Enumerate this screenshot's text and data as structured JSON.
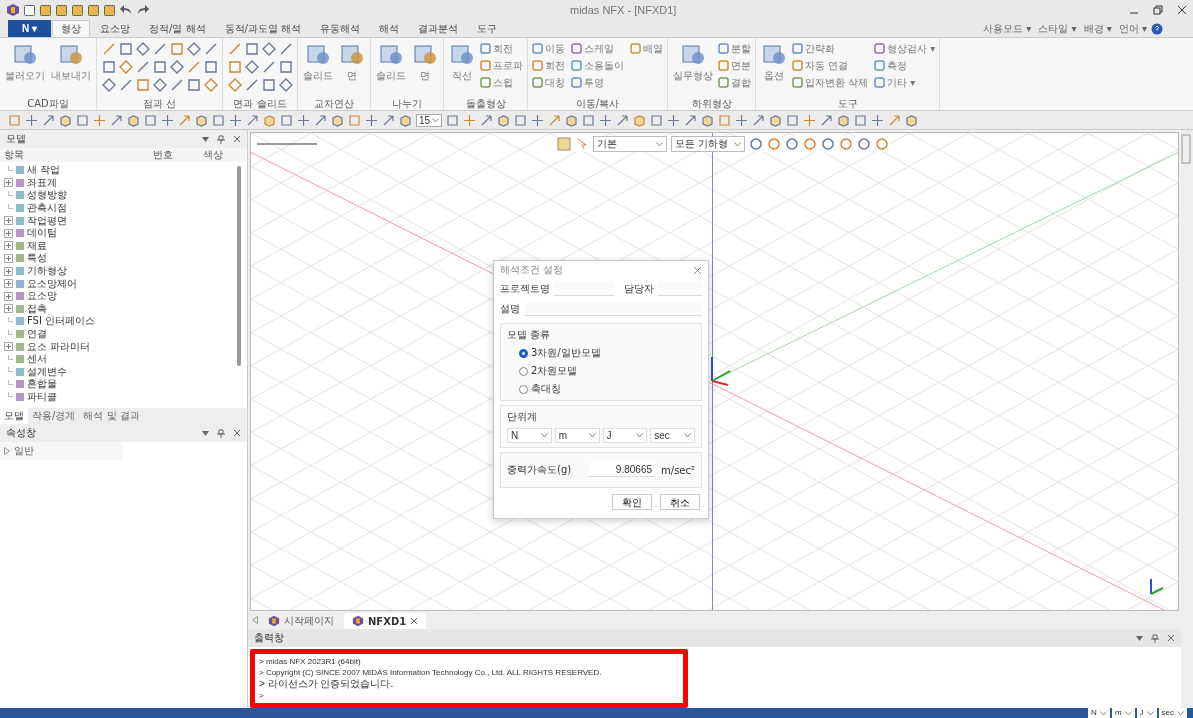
{
  "window": {
    "title": "midas NFX - [NFXD1]"
  },
  "top_right_menu": [
    "사용모드 ▾",
    "스타일 ▾",
    "배경 ▾",
    "언어 ▾"
  ],
  "app_menu": {
    "label": "N ▾"
  },
  "ribbon_tabs": [
    {
      "label": "형상",
      "selected": true
    },
    {
      "label": "요소망",
      "selected": false
    },
    {
      "label": "정적/열 해석",
      "selected": false
    },
    {
      "label": "동적/과도열 해석",
      "selected": false
    },
    {
      "label": "유동해석",
      "selected": false
    },
    {
      "label": "해석",
      "selected": false
    },
    {
      "label": "결과분석",
      "selected": false
    },
    {
      "label": "도구",
      "selected": false
    }
  ],
  "ribbon_groups": [
    {
      "kind": "large",
      "label": "CAD파일",
      "buttons": [
        "불러오기",
        "내보내기"
      ]
    },
    {
      "kind": "grid",
      "label": "점과 선"
    },
    {
      "kind": "grid",
      "label": "면과 솔리드"
    },
    {
      "kind": "large",
      "label": "교차연산",
      "buttons": [
        "솔리드",
        "면"
      ]
    },
    {
      "kind": "large",
      "label": "나누기",
      "buttons": [
        "솔리드",
        "면"
      ]
    },
    {
      "kind": "mixed",
      "label": "돌출형상",
      "buttons": [
        "직선"
      ],
      "items": [
        "회전",
        "프로파",
        "스윕"
      ]
    },
    {
      "kind": "mixed",
      "label": "이동/복사",
      "items": [
        "이동",
        "회전",
        "대칭",
        "스케일",
        "소용돌이",
        "투영",
        "배열"
      ]
    },
    {
      "kind": "mixed",
      "label": "하위형상",
      "buttons": [
        "실무형상"
      ],
      "items": [
        "분할",
        "면분",
        "결합"
      ]
    },
    {
      "kind": "mixed",
      "label": "도구",
      "buttons": [
        "옵션"
      ],
      "items": [
        "간략화",
        "자동 연결",
        "입자변환 삭제",
        "형상검사 ▾",
        "측정",
        "기타 ▾"
      ]
    }
  ],
  "toolbar": {
    "step_value": "15"
  },
  "model_panel": {
    "title": "모델",
    "columns": [
      "항목",
      "번호",
      "색상"
    ],
    "tree": [
      {
        "label": "새 작업",
        "expandable": false
      },
      {
        "label": "좌표계",
        "expandable": true
      },
      {
        "label": "성형방향",
        "expandable": false
      },
      {
        "label": "관측시점",
        "expandable": false
      },
      {
        "label": "작업평면",
        "expandable": true
      },
      {
        "label": "데이텀",
        "expandable": true
      },
      {
        "label": "재료",
        "expandable": true
      },
      {
        "label": "특성",
        "expandable": true
      },
      {
        "label": "기하형상",
        "expandable": true
      },
      {
        "label": "요소망제어",
        "expandable": true
      },
      {
        "label": "요소망",
        "expandable": true
      },
      {
        "label": "접촉",
        "expandable": true
      },
      {
        "label": "FSI 인터페이스",
        "expandable": false
      },
      {
        "label": "연결",
        "expandable": false
      },
      {
        "label": "요소 파라미터",
        "expandable": true
      },
      {
        "label": "센서",
        "expandable": false
      },
      {
        "label": "설계변수",
        "expandable": false
      },
      {
        "label": "혼합물",
        "expandable": false
      },
      {
        "label": "파티클",
        "expandable": false
      }
    ],
    "tabs": [
      {
        "label": "모델",
        "selected": true
      },
      {
        "label": "작용/경계",
        "selected": false
      },
      {
        "label": "해석 및 결과",
        "selected": false
      }
    ]
  },
  "property_panel": {
    "title": "속성창",
    "rows": [
      "일반"
    ]
  },
  "view_toolbar": {
    "style_combo": "기본",
    "filter_combo": "모든 기하형"
  },
  "dialog": {
    "title": "해석조건 설정",
    "project_label": "프로젝트명",
    "owner_label": "담당자",
    "description_label": "설명",
    "model_type": {
      "title": "모델 종류",
      "options": [
        {
          "label": "3차원/일반모델",
          "selected": true
        },
        {
          "label": "2차원모델",
          "selected": false
        },
        {
          "label": "축대칭",
          "selected": false
        }
      ]
    },
    "units": {
      "title": "단위계",
      "values": [
        "N",
        "m",
        "J",
        "sec"
      ]
    },
    "gravity": {
      "label": "중력가속도(g)",
      "value": "9.80665",
      "unit": "m/sec²"
    },
    "buttons": [
      "확인",
      "취소"
    ]
  },
  "doc_tabs": [
    {
      "label": "시작페이지",
      "selected": false,
      "closable": false
    },
    {
      "label": "NFXD1",
      "selected": true,
      "closable": true
    }
  ],
  "output": {
    "title": "출력창",
    "lines": [
      "> midas NFX 2023R1 (64bit)",
      "> Copyright (C) SINCE 2007 MIDAS Information Technology Co., Ltd. ALL RIGHTS RESERVED.",
      "> 라이선스가 인증되었습니다.",
      ">"
    ],
    "highlighted": true
  },
  "status_units": [
    "N",
    "m",
    "J",
    "sec"
  ]
}
